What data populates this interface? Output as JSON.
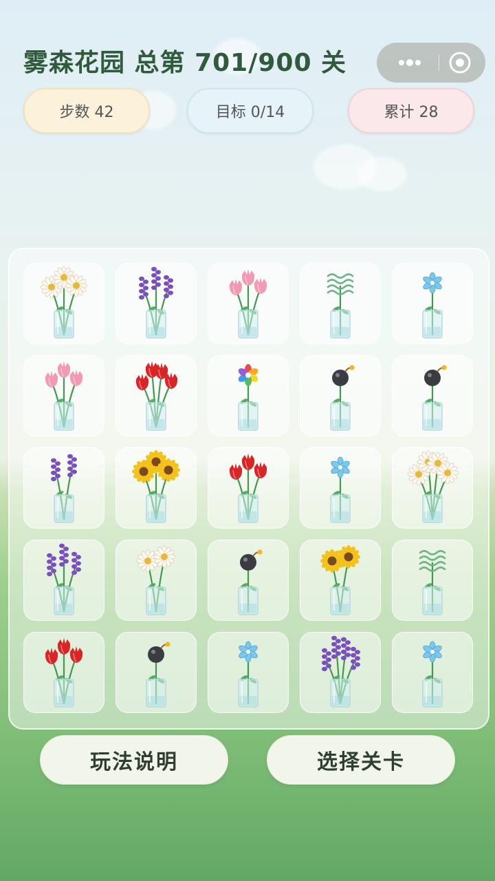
{
  "header": {
    "title": "雾森花园 总第 701/900 关"
  },
  "stats": {
    "steps": "步数 42",
    "goal": "目标 0/14",
    "total": "累计 28"
  },
  "board": {
    "rows": 5,
    "cols": 5,
    "cells": [
      {
        "flower": "daisy",
        "count": 3
      },
      {
        "flower": "lavender",
        "count": 3
      },
      {
        "flower": "pink-tulip",
        "count": 3
      },
      {
        "flower": "wavy-grass",
        "count": 1
      },
      {
        "flower": "blue-star",
        "count": 1
      },
      {
        "flower": "pink-tulip",
        "count": 3
      },
      {
        "flower": "red-tulip",
        "count": 4
      },
      {
        "flower": "rainbow-flower",
        "count": 1
      },
      {
        "flower": "bomb",
        "count": 1
      },
      {
        "flower": "bomb",
        "count": 1
      },
      {
        "flower": "lavender",
        "count": 2
      },
      {
        "flower": "sunflower",
        "count": 3
      },
      {
        "flower": "red-tulip",
        "count": 3
      },
      {
        "flower": "blue-star",
        "count": 1
      },
      {
        "flower": "daisy",
        "count": 4
      },
      {
        "flower": "lavender",
        "count": 3
      },
      {
        "flower": "daisy",
        "count": 2
      },
      {
        "flower": "bomb",
        "count": 1
      },
      {
        "flower": "sunflower",
        "count": 2
      },
      {
        "flower": "wavy-grass",
        "count": 1
      },
      {
        "flower": "red-tulip",
        "count": 3
      },
      {
        "flower": "bomb",
        "count": 1
      },
      {
        "flower": "blue-star",
        "count": 1
      },
      {
        "flower": "lavender",
        "count": 4
      },
      {
        "flower": "blue-star",
        "count": 1
      }
    ]
  },
  "buttons": {
    "help": "玩法说明",
    "select": "选择关卡"
  },
  "colors": {
    "title": "#2f5a3c",
    "daisy": "#fffaf0",
    "daisy_center": "#e8b838",
    "lavender": "#7a4fc0",
    "pink_tulip": "#f29ab4",
    "red_tulip": "#d92525",
    "sunflower": "#f5c21b",
    "sunflower_center": "#7a4a1a",
    "blue_star": "#7cc7ea",
    "stem": "#3f9a4e",
    "bomb": "#3b3b42"
  }
}
